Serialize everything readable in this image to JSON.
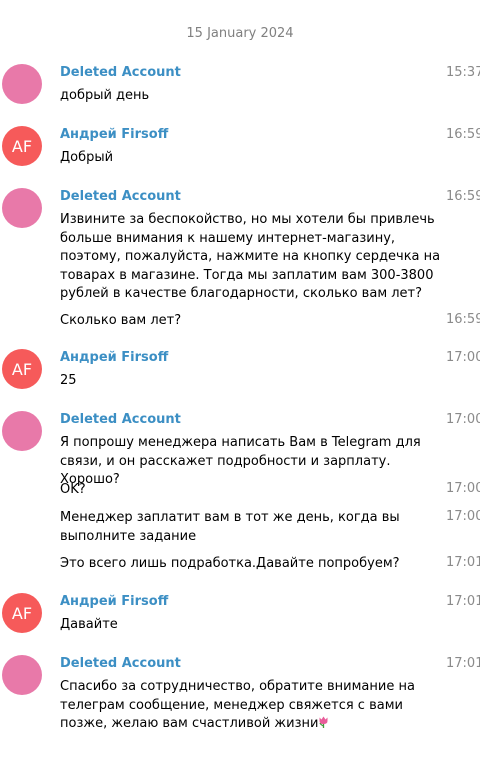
{
  "chat": {
    "date": "15 January 2024",
    "colors": {
      "deleted_avatar": "#e879a9",
      "af_avatar": "#f65a5a",
      "author_name": "#3c8fc4"
    },
    "groups": [
      {
        "author": "Deleted Account",
        "avatar_initials": "",
        "messages": [
          {
            "text": "добрый день",
            "time": "15:37"
          }
        ]
      },
      {
        "author": "Андрей Firsoff",
        "avatar_initials": "AF",
        "messages": [
          {
            "text": "Добрый",
            "time": "16:59"
          }
        ]
      },
      {
        "author": "Deleted Account",
        "avatar_initials": "",
        "messages": [
          {
            "text": "Извините за беспокойство, но мы хотели бы привлечь больше внимания к нашему интернет-магазину, поэтому, пожалуйста, нажмите на кнопку сердечка на товарах в магазине. Тогда мы заплатим вам 300-3800 рублей в качестве благодарности, сколько вам лет?",
            "time": "16:59"
          },
          {
            "text": "Сколько вам лет?",
            "time": "16:59"
          }
        ]
      },
      {
        "author": "Андрей Firsoff",
        "avatar_initials": "AF",
        "messages": [
          {
            "text": "25",
            "time": "17:00"
          }
        ]
      },
      {
        "author": "Deleted Account",
        "avatar_initials": "",
        "messages": [
          {
            "text": "Я попрошу менеджера написать Вам в Telegram для связи, и он расскажет подробности и зарплату. Хорошо?",
            "time": "17:00"
          },
          {
            "text": "OK?",
            "time": "17:00"
          },
          {
            "text": "Менеджер заплатит вам в тот же день, когда вы выполните задание",
            "time": "17:00"
          },
          {
            "text": "Это всего лишь подработка.Давайте попробуем?",
            "time": "17:01"
          }
        ]
      },
      {
        "author": "Андрей Firsoff",
        "avatar_initials": "AF",
        "messages": [
          {
            "text": "Давайте",
            "time": "17:01"
          }
        ]
      },
      {
        "author": "Deleted Account",
        "avatar_initials": "",
        "messages": [
          {
            "text": "Спасибо за сотрудничество, обратите внимание на телеграм сообщение, менеджер свяжется с вами позже, желаю вам счастливой жизни",
            "time": "17:01",
            "emoji": "tulip-icon"
          }
        ]
      }
    ]
  }
}
